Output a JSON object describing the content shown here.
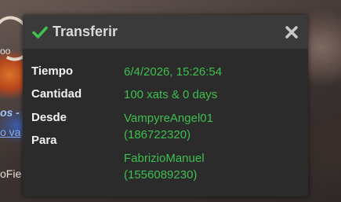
{
  "background": {
    "fragment_1": "oo",
    "fragment_2": "os -",
    "fragment_3": "o va",
    "fragment_4": "oFie"
  },
  "modal": {
    "title": "Transferir",
    "header_icon": "check-icon",
    "close_icon": "close-icon",
    "accent_color": "#3fbf4f",
    "rows": {
      "time_label": "Tiempo",
      "time_value": "6/4/2026, 15:26:54",
      "amount_label": "Cantidad",
      "amount_value": "100 xats & 0 days",
      "from_label": "Desde",
      "from_name": "VampyreAngel01",
      "from_id": "(186722320)",
      "to_label": "Para",
      "to_name": "FabrizioManuel",
      "to_id": "(1556089230)"
    }
  }
}
